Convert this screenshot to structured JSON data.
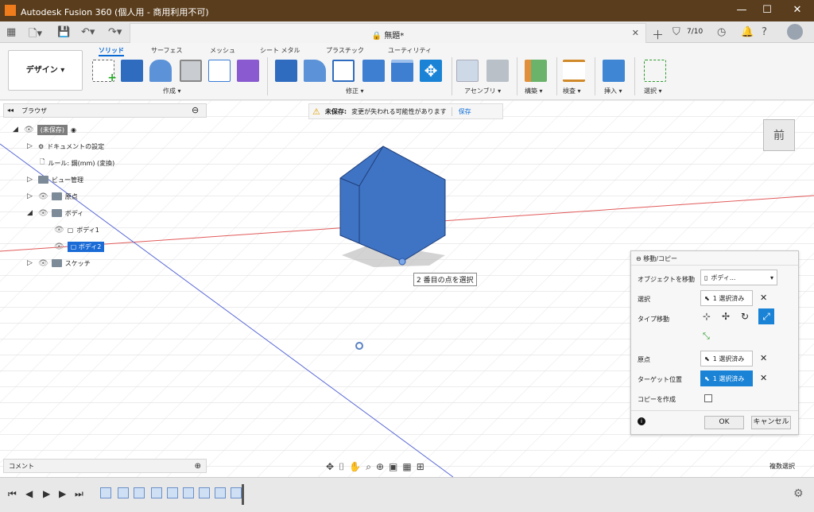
{
  "title_bar": {
    "title": "Autodesk Fusion 360 (個人用 - 商用利用不可)",
    "minimize": "—",
    "maximize": "☐",
    "close": "✕"
  },
  "doc_tab": {
    "title": "無題*",
    "close": "✕"
  },
  "header_right": {
    "job_status": "7/10"
  },
  "design_workspace": "デザイン ▾",
  "tabs": [
    "ソリッド",
    "サーフェス",
    "メッシュ",
    "シート メタル",
    "プラスチック",
    "ユーティリティ"
  ],
  "groups": [
    "作成 ▾",
    "修正 ▾",
    "アセンブリ ▾",
    "構築 ▾",
    "検査 ▾",
    "挿入 ▾",
    "選択 ▾"
  ],
  "browser": {
    "header": "ブラウザ",
    "items": [
      {
        "label": "(未保存)"
      },
      {
        "label": "ドキュメントの設定"
      },
      {
        "label": "ルール: 鋼(mm) (変換)"
      },
      {
        "label": "ビュー管理"
      },
      {
        "label": "原点"
      },
      {
        "label": "ボディ"
      },
      {
        "label": "ボディ1"
      },
      {
        "label": "ボディ2"
      },
      {
        "label": "スケッチ"
      }
    ]
  },
  "warning": {
    "label": "未保存:",
    "message": "変更が失われる可能性があります",
    "save": "保存"
  },
  "viewcube": {
    "label": "前"
  },
  "tooltip": "2 番目の点を選択",
  "dialog": {
    "title": "移動/コピー",
    "rows": [
      {
        "label": "オブジェクトを移動",
        "value": "ボディ..."
      },
      {
        "label": "選択",
        "value": "1 選択済み"
      },
      {
        "label": "タイプ移動",
        "value": ""
      },
      {
        "label": "原点",
        "value": "1 選択済み"
      },
      {
        "label": "ターゲット位置",
        "value": "1 選択済み"
      },
      {
        "label": "コピーを作成",
        "value": ""
      }
    ],
    "ok": "OK",
    "cancel": "キャンセル"
  },
  "comment": "コメント",
  "multi_select": "複数選択",
  "colors": {
    "accent": "#1a83d6",
    "body_fill": "#3f73c4",
    "title_bar": "#5a3d1c"
  }
}
